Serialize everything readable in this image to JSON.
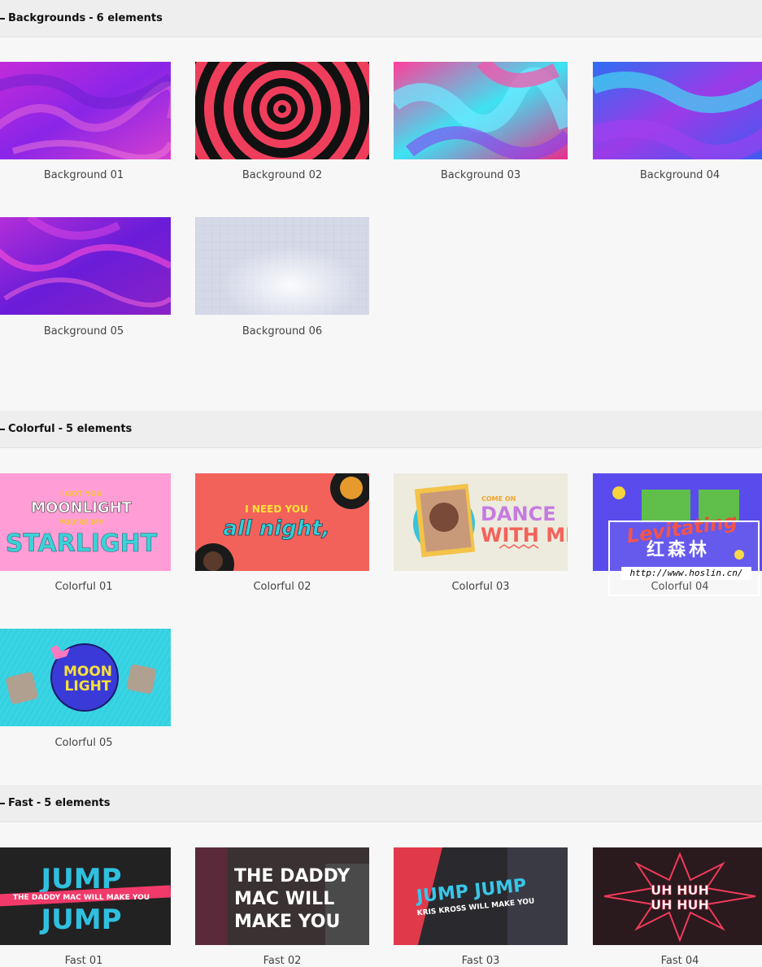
{
  "sections": [
    {
      "title": "Backgrounds",
      "count": "6 elements",
      "items": [
        "Background 01",
        "Background 02",
        "Background 03",
        "Background 04",
        "Background 05",
        "Background 06"
      ]
    },
    {
      "title": "Colorful",
      "count": "5 elements",
      "items": [
        "Colorful 01",
        "Colorful 02",
        "Colorful 03",
        "Colorful 04",
        "Colorful 05"
      ]
    },
    {
      "title": "Fast",
      "count": "5 elements",
      "items": [
        "Fast 01",
        "Fast 02",
        "Fast 03",
        "Fast 04"
      ]
    }
  ],
  "thumb_text": {
    "colorful01": [
      "I GOT YOU",
      "MOONLIGHT",
      "YOU'RE MY",
      "STARLIGHT"
    ],
    "colorful02": [
      "I NEED YOU",
      "all night,"
    ],
    "colorful03": [
      "COME ON",
      "DANCE",
      "WITH ME"
    ],
    "colorful04": [
      "Levitating"
    ],
    "colorful05": [
      "MOON",
      "LIGHT"
    ],
    "fast01": [
      "JUMP",
      "THE DADDY MAC WILL MAKE YOU",
      "JUMP"
    ],
    "fast02": [
      "THE DADDY",
      "MAC WILL",
      "MAKE YOU"
    ],
    "fast03": [
      "JUMP JUMP",
      "KRIS KROSS WILL MAKE YOU"
    ],
    "fast04": [
      "UH HUH",
      "UH HUH"
    ]
  },
  "watermark": {
    "name": "红森林",
    "url": "http://www.hoslin.cn/"
  }
}
